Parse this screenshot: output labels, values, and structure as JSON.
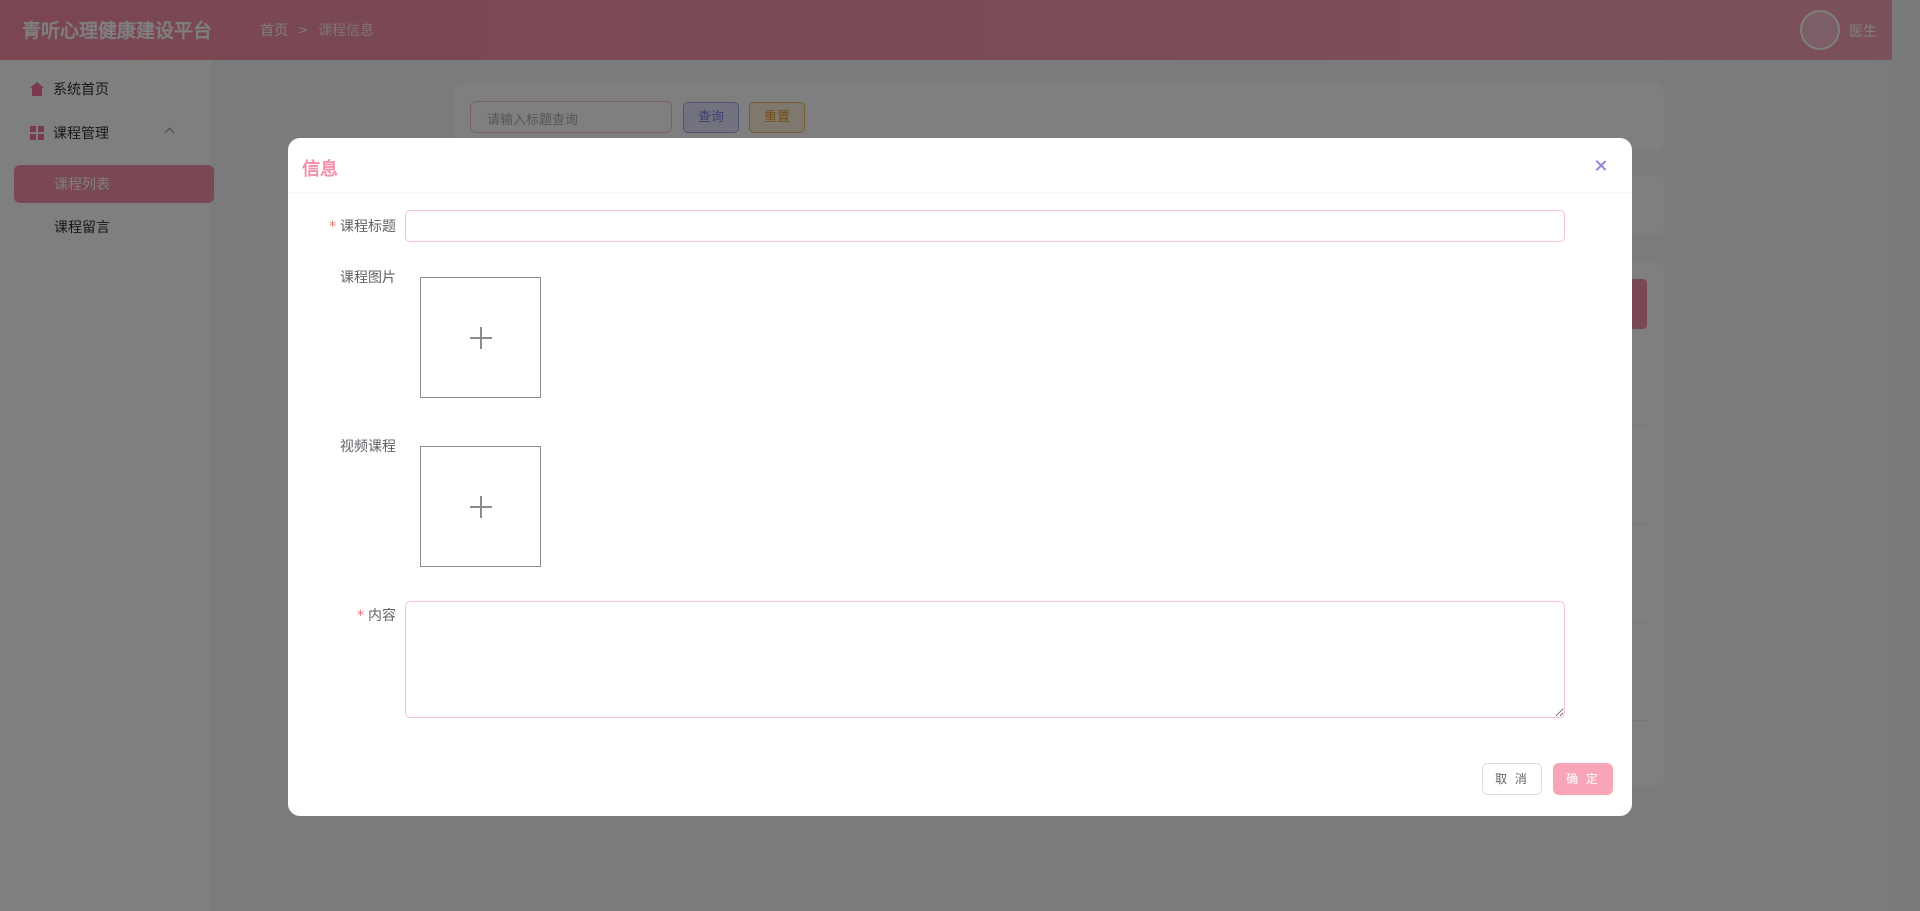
{
  "header": {
    "app_title": "青听心理健康建设平台",
    "breadcrumb": [
      "首页",
      "课程信息"
    ],
    "user_name": "医生"
  },
  "sidebar": {
    "items": [
      {
        "label": "系统首页",
        "icon": "home-icon"
      },
      {
        "label": "课程管理",
        "icon": "grid-icon",
        "expanded": true
      }
    ],
    "sub_items": [
      {
        "label": "课程列表",
        "active": true
      },
      {
        "label": "课程留言",
        "active": false
      }
    ]
  },
  "background": {
    "search_placeholder": "请输入标题查询",
    "query_label": "查询",
    "reset_label": "重置"
  },
  "dialog": {
    "title": "信息",
    "fields": {
      "title_label": "课程标题",
      "image_label": "课程图片",
      "video_label": "视频课程",
      "content_label": "内容",
      "required_mark": "*"
    },
    "title_value": "",
    "content_value": "",
    "cancel_label": "取 消",
    "confirm_label": "确 定"
  },
  "colors": {
    "accent": "#f590a8",
    "header": "#f58ca5",
    "required": "#f56c6c",
    "query_button": "#7b78e9",
    "reset_button": "#e69a2e"
  }
}
